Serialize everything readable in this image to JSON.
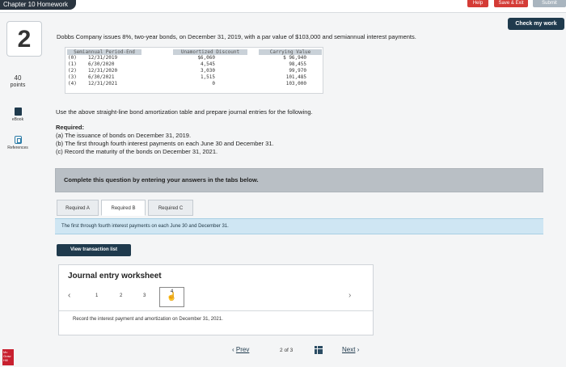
{
  "topbar": {
    "chapter": "Chapter 10 Homework",
    "help": "Help",
    "save_exit": "Save & Exit",
    "submit": "Submit"
  },
  "check_work": "Check my work",
  "question": {
    "number": "2",
    "points_value": "40",
    "points_label": "points",
    "text": "Dobbs Company issues 8%, two-year bonds, on December 31, 2019, with a par value of $103,000 and semiannual interest payments."
  },
  "sidebar": {
    "ebook": "eBook",
    "references": "References"
  },
  "amortization": {
    "headers": [
      "Semiannual Period-End",
      "Unamortized Discount",
      "Carrying Value"
    ],
    "rows": [
      {
        "idx": "(0)",
        "date": "12/31/2019",
        "discount": "$6,060",
        "carrying": "$ 96,940"
      },
      {
        "idx": "(1)",
        "date": "6/30/2020",
        "discount": "4,545",
        "carrying": "98,455"
      },
      {
        "idx": "(2)",
        "date": "12/31/2020",
        "discount": "3,030",
        "carrying": "99,970"
      },
      {
        "idx": "(3)",
        "date": "6/30/2021",
        "discount": "1,515",
        "carrying": "101,485"
      },
      {
        "idx": "(4)",
        "date": "12/31/2021",
        "discount": "0",
        "carrying": "103,000"
      }
    ]
  },
  "instructions": "Use the above straight-line bond amortization table and prepare journal entries for the following.",
  "required": {
    "title": "Required:",
    "a": "(a) The issuance of bonds on December 31, 2019.",
    "b": "(b) The first through fourth interest payments on each June 30 and December 31.",
    "c": "(c) Record the maturity of the bonds on December 31, 2021."
  },
  "complete_bar": "Complete this question by entering your answers in the tabs below.",
  "tabs": [
    "Required A",
    "Required B",
    "Required C"
  ],
  "tab_description": "The first through fourth interest payments on each June 30 and December 31.",
  "view_transaction_list": "View transaction list",
  "worksheet": {
    "title": "Journal entry worksheet",
    "prev_arrow": "‹",
    "next_arrow": "›",
    "pages": [
      "1",
      "2",
      "3",
      "4"
    ],
    "description": "Record the interest payment and amortization on December 31, 2021."
  },
  "bottom_nav": {
    "prev": "Prev",
    "page_current": "2",
    "page_of": "of",
    "page_total": "3",
    "next": "Next"
  },
  "colors": {
    "accent_dark": "#1f3a4d",
    "brand_red": "#d43b36",
    "band_blue": "#cfe6f3"
  }
}
